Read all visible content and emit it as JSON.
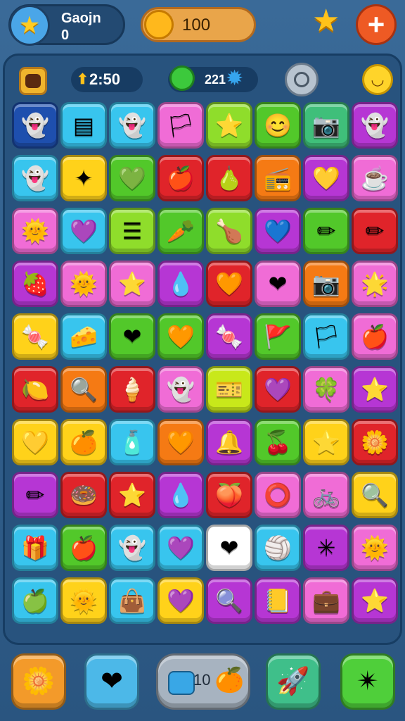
{
  "header": {
    "player_name": "Gaojn",
    "player_level": "0",
    "coins": "100"
  },
  "board_stats": {
    "score": "2:50",
    "gems": "221"
  },
  "grid": {
    "rows": [
      [
        {
          "color": "#1e4fae",
          "icon": "ghost-icon",
          "g": "👻"
        },
        {
          "color": "#38c5ee",
          "icon": "flag-stripes-icon",
          "g": "▤"
        },
        {
          "color": "#38c5ee",
          "icon": "ghost-icon",
          "g": "👻"
        },
        {
          "color": "#f06cd6",
          "icon": "flag-icon",
          "g": "🏳"
        },
        {
          "color": "#8fdd2b",
          "icon": "star-icon",
          "g": "⭐"
        },
        {
          "color": "#52c82a",
          "icon": "face-icon",
          "g": "😊"
        },
        {
          "color": "#3fbf7a",
          "icon": "camera-icon",
          "g": "📷"
        },
        {
          "color": "#b636d4",
          "icon": "ghost-icon",
          "g": "👻"
        }
      ],
      [
        {
          "color": "#38c5ee",
          "icon": "ghost-icon",
          "g": "👻"
        },
        {
          "color": "#ffd21a",
          "icon": "sparkle-icon",
          "g": "✦"
        },
        {
          "color": "#52c82a",
          "icon": "leaf-heart-icon",
          "g": "💚"
        },
        {
          "color": "#e0242a",
          "icon": "apple-icon",
          "g": "🍎"
        },
        {
          "color": "#e0242a",
          "icon": "pear-icon",
          "g": "🍐"
        },
        {
          "color": "#f57a14",
          "icon": "radio-icon",
          "g": "📻"
        },
        {
          "color": "#b636d4",
          "icon": "heart-icon",
          "g": "💛"
        },
        {
          "color": "#f06cd6",
          "icon": "cup-icon",
          "g": "☕"
        }
      ],
      [
        {
          "color": "#f06cd6",
          "icon": "sun-face-icon",
          "g": "🌞"
        },
        {
          "color": "#38c5ee",
          "icon": "heart-icon",
          "g": "💜"
        },
        {
          "color": "#8fdd2b",
          "icon": "stack-icon",
          "g": "☰"
        },
        {
          "color": "#52c82a",
          "icon": "carrot-icon",
          "g": "🥕"
        },
        {
          "color": "#8fdd2b",
          "icon": "drumstick-icon",
          "g": "🍗"
        },
        {
          "color": "#b636d4",
          "icon": "heart-icon",
          "g": "💙"
        },
        {
          "color": "#52c82a",
          "icon": "pencil-icon",
          "g": "✏"
        },
        {
          "color": "#e0242a",
          "icon": "pencil-icon",
          "g": "✏"
        }
      ],
      [
        {
          "color": "#b636d4",
          "icon": "strawberry-icon",
          "g": "🍓"
        },
        {
          "color": "#f06cd6",
          "icon": "sun-face-icon",
          "g": "🌞"
        },
        {
          "color": "#f06cd6",
          "icon": "star-icon",
          "g": "⭐"
        },
        {
          "color": "#b636d4",
          "icon": "drop-icon",
          "g": "💧"
        },
        {
          "color": "#e0242a",
          "icon": "heart-icon",
          "g": "🧡"
        },
        {
          "color": "#f06cd6",
          "icon": "heart-icon",
          "g": "❤"
        },
        {
          "color": "#f57a14",
          "icon": "camera-icon",
          "g": "📷"
        },
        {
          "color": "#f06cd6",
          "icon": "star-face-icon",
          "g": "🌟"
        }
      ],
      [
        {
          "color": "#ffd21a",
          "icon": "candy-icon",
          "g": "🍬"
        },
        {
          "color": "#38c5ee",
          "icon": "cheese-icon",
          "g": "🧀"
        },
        {
          "color": "#52c82a",
          "icon": "heart-icon",
          "g": "❤"
        },
        {
          "color": "#52c82a",
          "icon": "heart-icon",
          "g": "🧡"
        },
        {
          "color": "#b636d4",
          "icon": "candy-icon",
          "g": "🍬"
        },
        {
          "color": "#52c82a",
          "icon": "flag-icon",
          "g": "🚩"
        },
        {
          "color": "#38c5ee",
          "icon": "flag-icon",
          "g": "🏳"
        },
        {
          "color": "#f06cd6",
          "icon": "apple-icon",
          "g": "🍎"
        }
      ],
      [
        {
          "color": "#e0242a",
          "icon": "lemon-icon",
          "g": "🍋"
        },
        {
          "color": "#f57a14",
          "icon": "magnifier-icon",
          "g": "🔍"
        },
        {
          "color": "#e0242a",
          "icon": "popsicle-icon",
          "g": "🍦"
        },
        {
          "color": "#f06cd6",
          "icon": "ghost-icon",
          "g": "👻"
        },
        {
          "color": "#c8e81a",
          "icon": "ticket-icon",
          "g": "🎫"
        },
        {
          "color": "#e0242a",
          "icon": "heart-icon",
          "g": "💜"
        },
        {
          "color": "#f06cd6",
          "icon": "leaf-icon",
          "g": "🍀"
        },
        {
          "color": "#b636d4",
          "icon": "star-icon",
          "g": "⭐"
        }
      ],
      [
        {
          "color": "#ffd21a",
          "icon": "heart-leaf-icon",
          "g": "💛"
        },
        {
          "color": "#ffd21a",
          "icon": "apple-icon",
          "g": "🍊"
        },
        {
          "color": "#38c5ee",
          "icon": "bottle-icon",
          "g": "🧴"
        },
        {
          "color": "#f57a14",
          "icon": "heart-icon",
          "g": "🧡"
        },
        {
          "color": "#b636d4",
          "icon": "bell-icon",
          "g": "🔔"
        },
        {
          "color": "#52c82a",
          "icon": "cherry-icon",
          "g": "🍒"
        },
        {
          "color": "#ffd21a",
          "icon": "star-icon",
          "g": "⭐"
        },
        {
          "color": "#e0242a",
          "icon": "flower-icon",
          "g": "🌼"
        }
      ],
      [
        {
          "color": "#b636d4",
          "icon": "pencil-icon",
          "g": "✏"
        },
        {
          "color": "#e0242a",
          "icon": "donut-icon",
          "g": "🍩"
        },
        {
          "color": "#e0242a",
          "icon": "star-icon",
          "g": "⭐"
        },
        {
          "color": "#b636d4",
          "icon": "drop-icon",
          "g": "💧"
        },
        {
          "color": "#e0242a",
          "icon": "apple-icon",
          "g": "🍑"
        },
        {
          "color": "#f06cd6",
          "icon": "ring-icon",
          "g": "⭕"
        },
        {
          "color": "#f06cd6",
          "icon": "bike-icon",
          "g": "🚲"
        },
        {
          "color": "#ffd21a",
          "icon": "magnifier-icon",
          "g": "🔍"
        }
      ],
      [
        {
          "color": "#38c5ee",
          "icon": "gift-icon",
          "g": "🎁"
        },
        {
          "color": "#52c82a",
          "icon": "apple-icon",
          "g": "🍎"
        },
        {
          "color": "#38c5ee",
          "icon": "ghost-icon",
          "g": "👻"
        },
        {
          "color": "#38c5ee",
          "icon": "heart-icon",
          "g": "💜"
        },
        {
          "color": "#ffffff",
          "icon": "heart-icon",
          "g": "❤"
        },
        {
          "color": "#38c5ee",
          "icon": "ball-icon",
          "g": "🏐"
        },
        {
          "color": "#b636d4",
          "icon": "snowflake-icon",
          "g": "✳"
        },
        {
          "color": "#f06cd6",
          "icon": "sun-face-icon",
          "g": "🌞"
        }
      ],
      [
        {
          "color": "#38c5ee",
          "icon": "cherry-icon",
          "g": "🍏"
        },
        {
          "color": "#ffd21a",
          "icon": "sun-icon",
          "g": "🌞"
        },
        {
          "color": "#38c5ee",
          "icon": "bag-icon",
          "g": "👜"
        },
        {
          "color": "#ffd21a",
          "icon": "heart-icon",
          "g": "💜"
        },
        {
          "color": "#b636d4",
          "icon": "magnifier-icon",
          "g": "🔍"
        },
        {
          "color": "#b636d4",
          "icon": "notebook-icon",
          "g": "📒"
        },
        {
          "color": "#f06cd6",
          "icon": "briefcase-icon",
          "g": "💼"
        },
        {
          "color": "#b636d4",
          "icon": "star-icon",
          "g": "⭐"
        }
      ]
    ]
  },
  "footer": {
    "booster_count": "10"
  }
}
